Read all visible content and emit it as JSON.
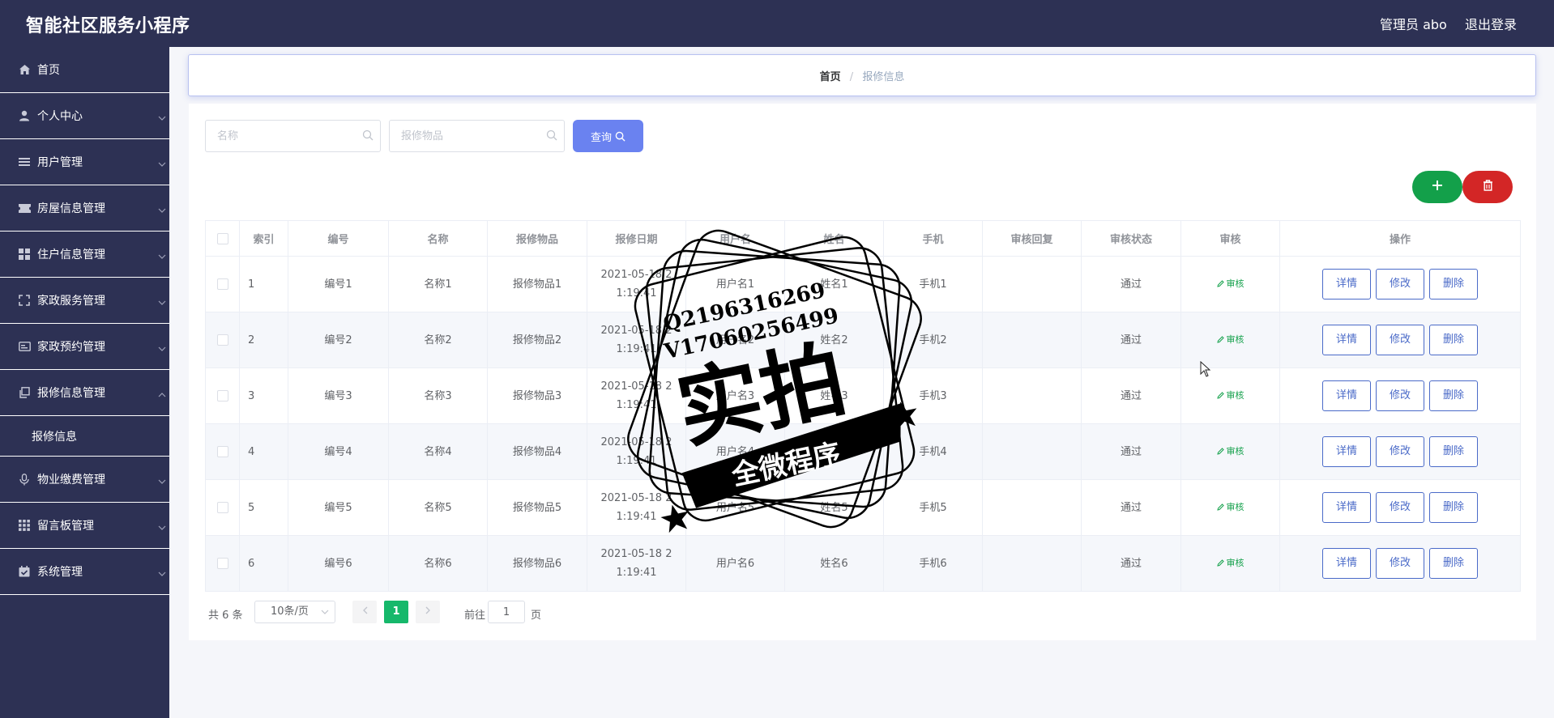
{
  "header": {
    "app_title": "智能社区服务小程序",
    "admin_label": "管理员 abo",
    "logout_label": "退出登录",
    "bg_color": "#2d3154"
  },
  "sidebar": {
    "items": [
      {
        "label": "首页",
        "icon": "home-icon",
        "expandable": false
      },
      {
        "label": "个人中心",
        "icon": "user-icon",
        "expandable": true
      },
      {
        "label": "用户管理",
        "icon": "list-icon",
        "expandable": true
      },
      {
        "label": "房屋信息管理",
        "icon": "ticket-icon",
        "expandable": true
      },
      {
        "label": "住户信息管理",
        "icon": "grid-icon",
        "expandable": true
      },
      {
        "label": "家政服务管理",
        "icon": "fullscreen-icon",
        "expandable": true
      },
      {
        "label": "家政预约管理",
        "icon": "id-card-icon",
        "expandable": true
      },
      {
        "label": "报修信息管理",
        "icon": "copy-icon",
        "expandable": true,
        "expanded": true,
        "children": [
          {
            "label": "报修信息"
          }
        ]
      },
      {
        "label": "物业缴费管理",
        "icon": "microphone-icon",
        "expandable": true
      },
      {
        "label": "留言板管理",
        "icon": "apps-icon",
        "expandable": true
      },
      {
        "label": "系统管理",
        "icon": "calendar-check-icon",
        "expandable": true
      }
    ]
  },
  "breadcrumb": {
    "home": "首页",
    "separator": "/",
    "current": "报修信息"
  },
  "search": {
    "name_placeholder": "名称",
    "item_placeholder": "报修物品",
    "query_label": "查询"
  },
  "toolbar": {
    "add_icon": "plus-icon",
    "delete_icon": "trash-icon",
    "add_color": "#13a04a",
    "delete_color": "#d32626"
  },
  "table": {
    "columns": [
      "索引",
      "编号",
      "名称",
      "报修物品",
      "报修日期",
      "用户名",
      "姓名",
      "手机",
      "审核回复",
      "审核状态",
      "审核",
      "操作"
    ],
    "rows": [
      {
        "index": "1",
        "code": "编号1",
        "name": "名称1",
        "item": "报修物品1",
        "date_line1": "2021-05-18 2",
        "date_line2": "1:19:41",
        "username": "用户名1",
        "realname": "姓名1",
        "phone": "手机1",
        "reply": "",
        "status": "通过",
        "audit": "审核"
      },
      {
        "index": "2",
        "code": "编号2",
        "name": "名称2",
        "item": "报修物品2",
        "date_line1": "2021-05-18 2",
        "date_line2": "1:19:41",
        "username": "用户名2",
        "realname": "姓名2",
        "phone": "手机2",
        "reply": "",
        "status": "通过",
        "audit": "审核"
      },
      {
        "index": "3",
        "code": "编号3",
        "name": "名称3",
        "item": "报修物品3",
        "date_line1": "2021-05-18 2",
        "date_line2": "1:19:41",
        "username": "用户名3",
        "realname": "姓名3",
        "phone": "手机3",
        "reply": "",
        "status": "通过",
        "audit": "审核"
      },
      {
        "index": "4",
        "code": "编号4",
        "name": "名称4",
        "item": "报修物品4",
        "date_line1": "2021-05-18 2",
        "date_line2": "1:19:41",
        "username": "用户名4",
        "realname": "姓名4",
        "phone": "手机4",
        "reply": "",
        "status": "通过",
        "audit": "审核"
      },
      {
        "index": "5",
        "code": "编号5",
        "name": "名称5",
        "item": "报修物品5",
        "date_line1": "2021-05-18 2",
        "date_line2": "1:19:41",
        "username": "用户名5",
        "realname": "姓名5",
        "phone": "手机5",
        "reply": "",
        "status": "通过",
        "audit": "审核"
      },
      {
        "index": "6",
        "code": "编号6",
        "name": "名称6",
        "item": "报修物品6",
        "date_line1": "2021-05-18 2",
        "date_line2": "1:19:41",
        "username": "用户名6",
        "realname": "姓名6",
        "phone": "手机6",
        "reply": "",
        "status": "通过",
        "audit": "审核"
      }
    ],
    "actions": {
      "detail": "详情",
      "edit": "修改",
      "delete": "删除"
    }
  },
  "pagination": {
    "total_text": "共 6 条",
    "page_size": "10条/页",
    "current_page": "1",
    "goto_label": "前往",
    "goto_value": "1",
    "goto_suffix": "页"
  },
  "watermark": {
    "line1": "Q2196316269",
    "line2": "V17060256499",
    "main": "实拍",
    "banner": "全微程序"
  }
}
